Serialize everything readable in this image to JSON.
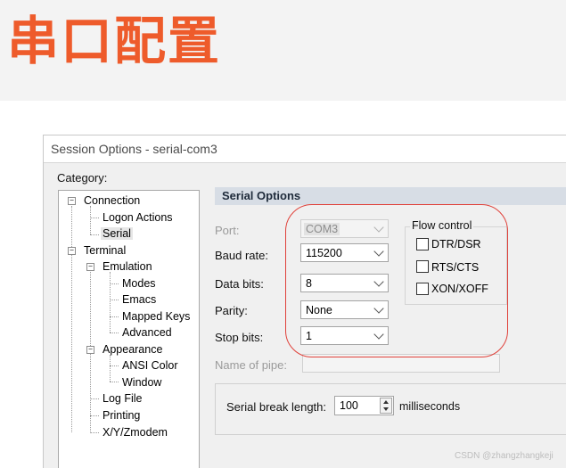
{
  "banner": {
    "title": "串口配置",
    "color": "#ee5b2b"
  },
  "window": {
    "title": "Session Options - serial-com3"
  },
  "category": {
    "label": "Category:",
    "items": [
      {
        "label": "Connection",
        "expanded": true
      },
      {
        "label": "Logon Actions"
      },
      {
        "label": "Serial",
        "selected": true
      },
      {
        "label": "Terminal",
        "expanded": true
      },
      {
        "label": "Emulation",
        "expanded": true
      },
      {
        "label": "Modes"
      },
      {
        "label": "Emacs"
      },
      {
        "label": "Mapped Keys"
      },
      {
        "label": "Advanced"
      },
      {
        "label": "Appearance",
        "expanded": true
      },
      {
        "label": "ANSI Color"
      },
      {
        "label": "Window"
      },
      {
        "label": "Log File"
      },
      {
        "label": "Printing"
      },
      {
        "label": "X/Y/Zmodem"
      }
    ]
  },
  "serial": {
    "header": "Serial Options",
    "port": {
      "label": "Port:",
      "value": "COM3",
      "disabled": true
    },
    "baud": {
      "label": "Baud rate:",
      "value": "115200"
    },
    "databits": {
      "label": "Data bits:",
      "value": "8"
    },
    "parity": {
      "label": "Parity:",
      "value": "None"
    },
    "stopbits": {
      "label": "Stop bits:",
      "value": "1"
    },
    "flow": {
      "legend": "Flow control",
      "options": [
        {
          "label": "DTR/DSR",
          "checked": false
        },
        {
          "label": "RTS/CTS",
          "checked": false
        },
        {
          "label": "XON/XOFF",
          "checked": false
        }
      ]
    },
    "pipe": {
      "label": "Name of pipe:",
      "value": ""
    },
    "break": {
      "label": "Serial break length:",
      "value": "100",
      "unit": "milliseconds"
    }
  },
  "annotation": {
    "color": "#e0413a"
  },
  "watermark": "CSDN @zhangzhangkeji"
}
